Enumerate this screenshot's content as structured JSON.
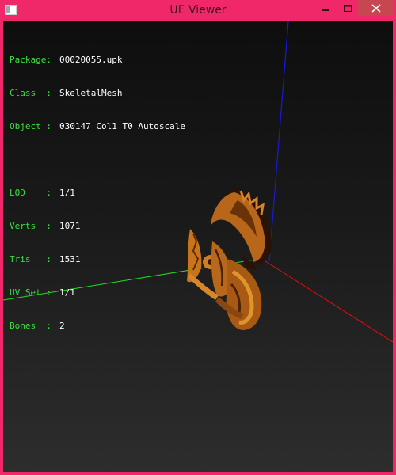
{
  "window": {
    "title": "UE Viewer",
    "controls": {
      "minimize": "minimize-icon",
      "maximize": "maximize-icon",
      "close": "close-icon"
    },
    "frame_color": "#f0286a"
  },
  "info": {
    "group1": [
      {
        "label": "Package:",
        "value": "00020055.upk"
      },
      {
        "label": "Class  :",
        "value": "SkeletalMesh"
      },
      {
        "label": "Object :",
        "value": "030147_Col1_T0_Autoscale"
      }
    ],
    "group2": [
      {
        "label": "LOD    :",
        "value": "1/1"
      },
      {
        "label": "Verts  :",
        "value": "1071"
      },
      {
        "label": "Tris   :",
        "value": "1531"
      },
      {
        "label": "UV Set :",
        "value": "1/1"
      },
      {
        "label": "Bones  :",
        "value": "2"
      }
    ],
    "label_color": "#37e13c",
    "value_color": "#ffffff"
  },
  "scene": {
    "axis_colors": {
      "x": "#e01010",
      "y": "#20e020",
      "z": "#1a1ad8"
    },
    "mesh_color": "#c8741a"
  }
}
